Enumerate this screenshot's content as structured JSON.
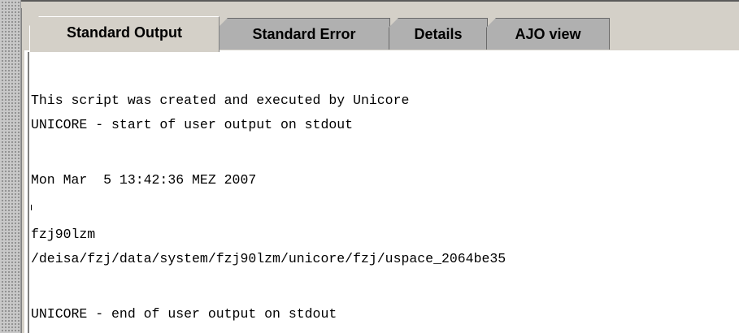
{
  "tabs": [
    {
      "label": "Standard Output",
      "active": true
    },
    {
      "label": "Standard Error",
      "active": false
    },
    {
      "label": "Details",
      "active": false
    },
    {
      "label": "AJO view",
      "active": false
    }
  ],
  "output": {
    "lines": [
      "This script was created and executed by Unicore",
      "UNICORE - start of user output on stdout",
      "Mon Mar  5 13:42:36 MEZ 2007",
      "fzj90lzm",
      "/deisa/fzj/data/system/fzj90lzm/unicore/fzj/uspace_2064be35",
      "UNICORE - end of user output on stdout"
    ]
  }
}
